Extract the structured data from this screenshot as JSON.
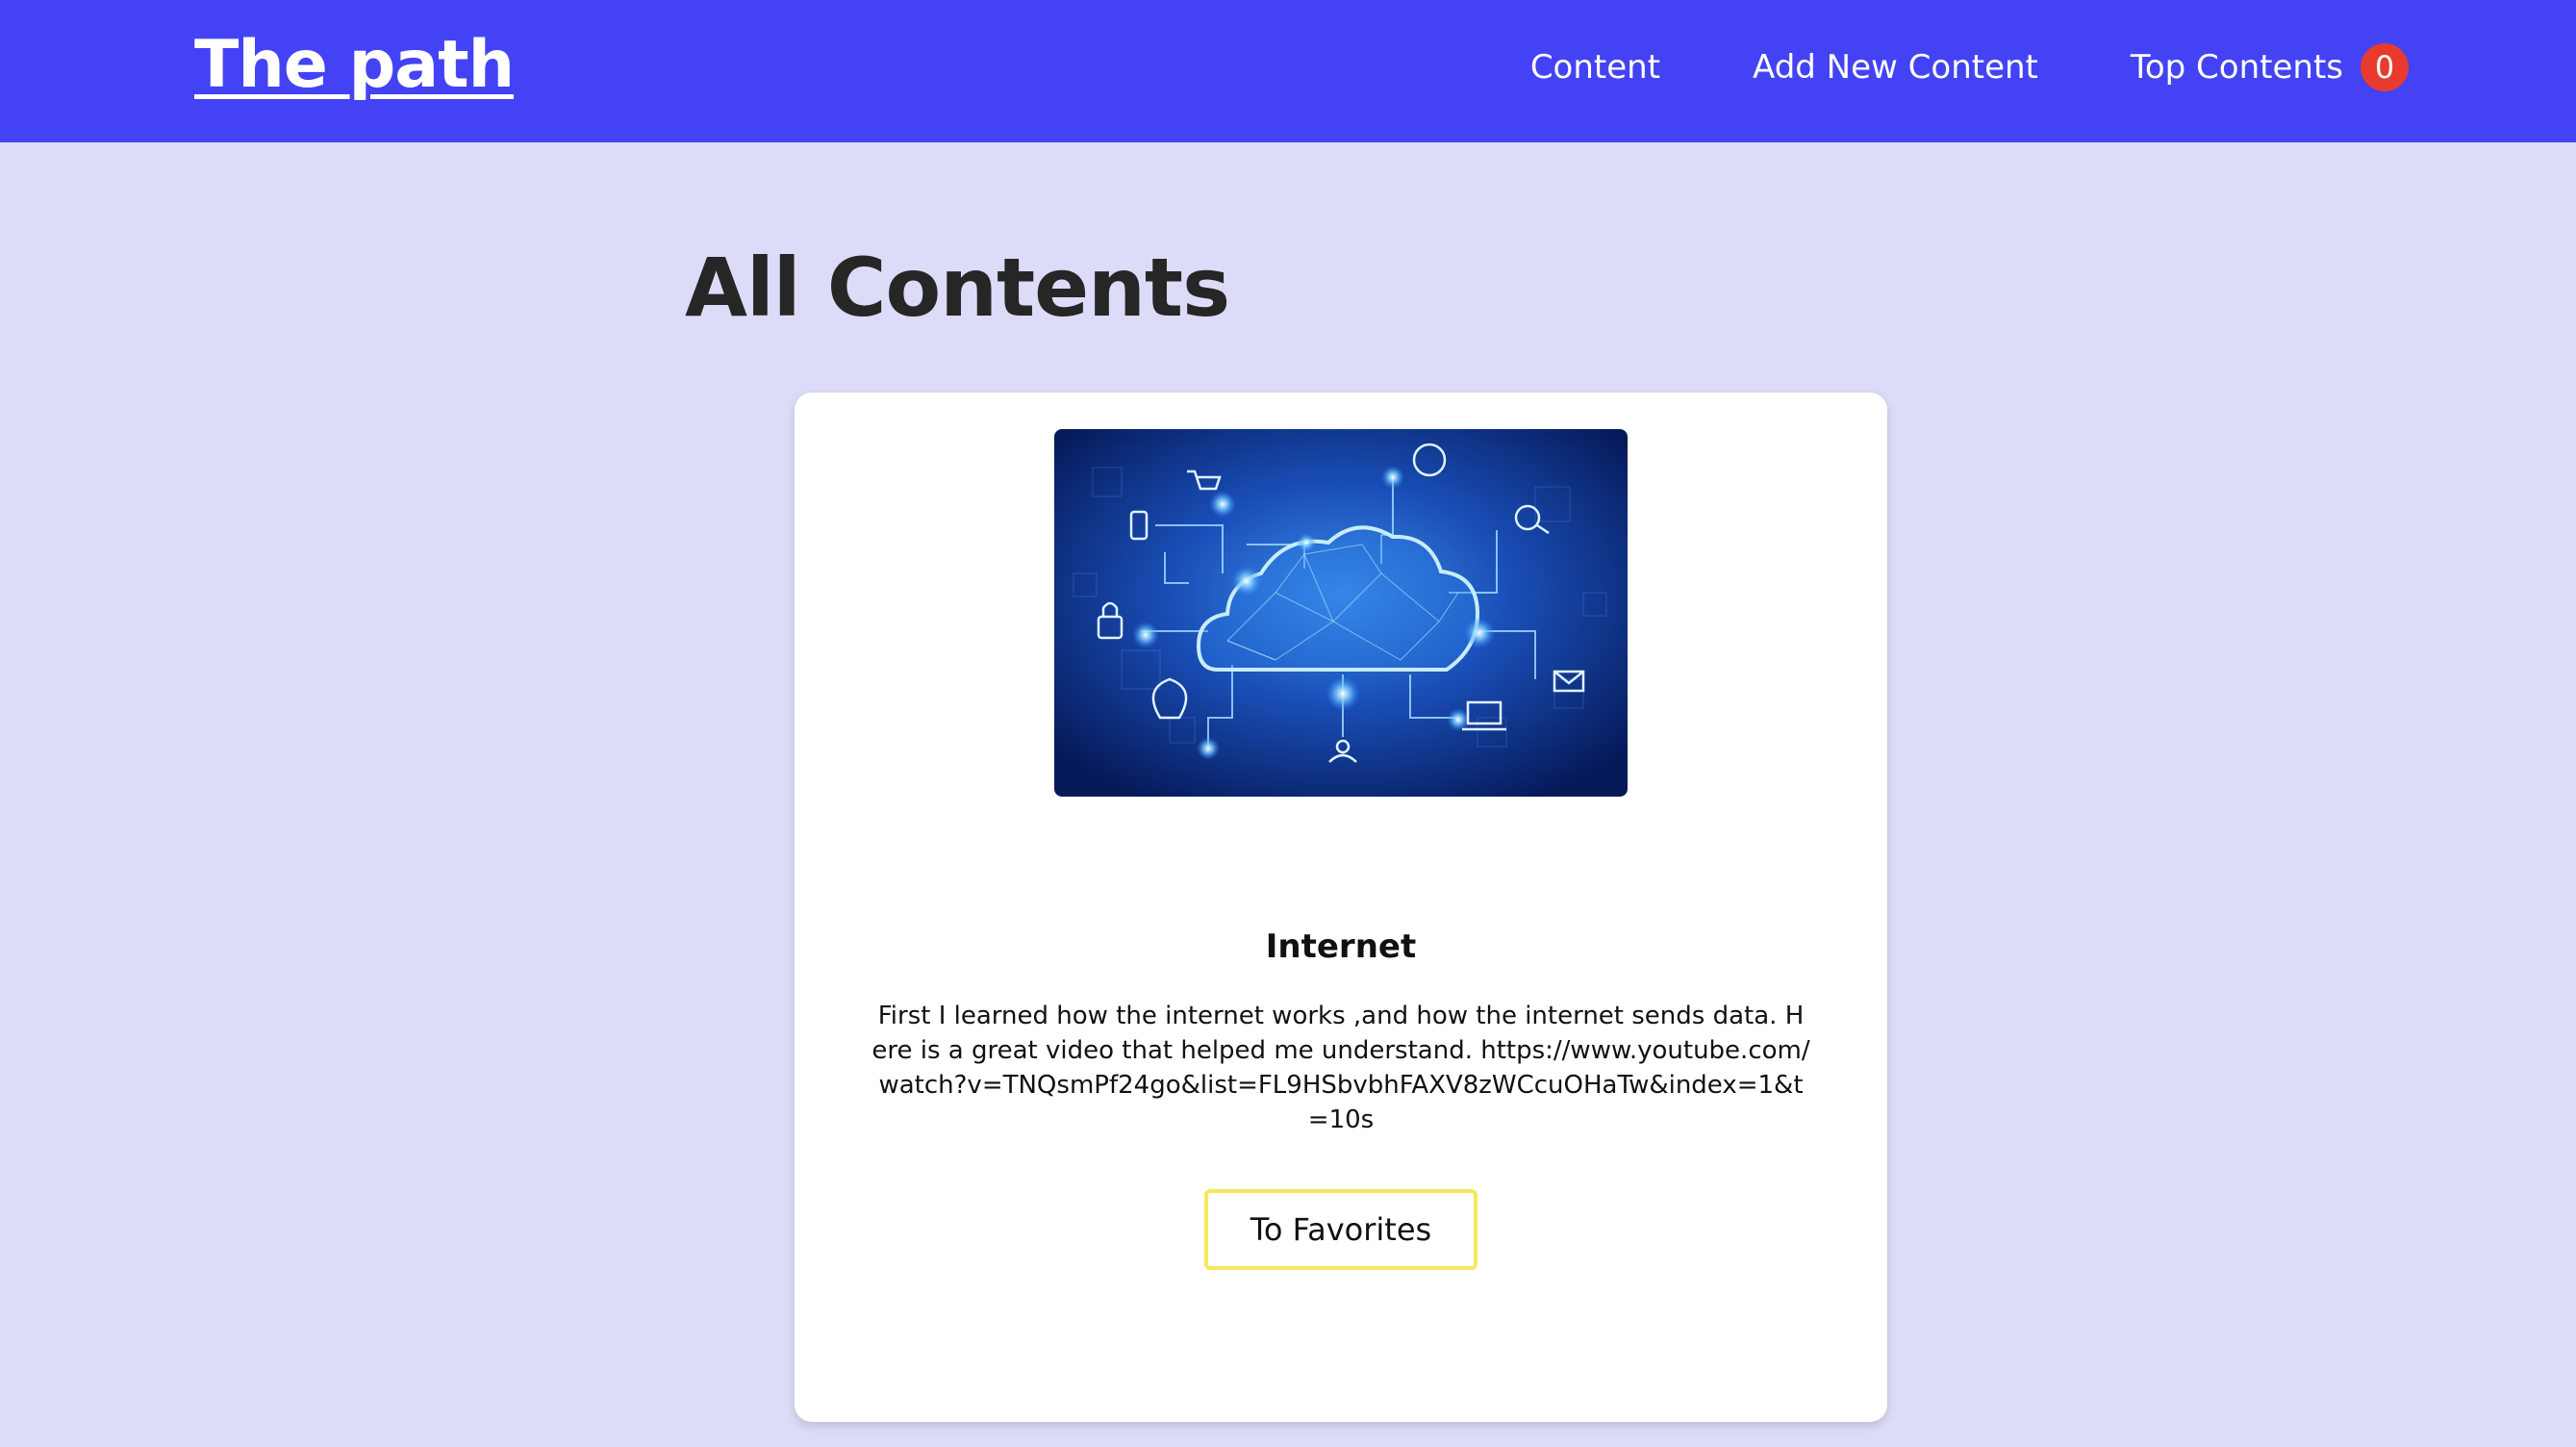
{
  "header": {
    "logo": "The path",
    "nav": [
      {
        "label": "Content"
      },
      {
        "label": "Add New Content"
      },
      {
        "label": "Top Contents",
        "badge": "0"
      }
    ]
  },
  "main": {
    "title": "All Contents",
    "cards": [
      {
        "image_icon": "cloud-network-image",
        "title": "Internet",
        "description": "First I learned how the internet works ,and how the internet sends data. Here is a great video that helped me understand. https://www.youtube.com/watch?v=TNQsmPf24go&list=FL9HSbvbhFAXV8zWCcuOHaTw&index=1&t=10s",
        "button_label": "To Favorites"
      }
    ]
  },
  "colors": {
    "header_bg": "#4343f5",
    "page_bg": "#dcdcf8",
    "badge_bg": "#e83b2e",
    "button_border": "#f6e85c"
  }
}
